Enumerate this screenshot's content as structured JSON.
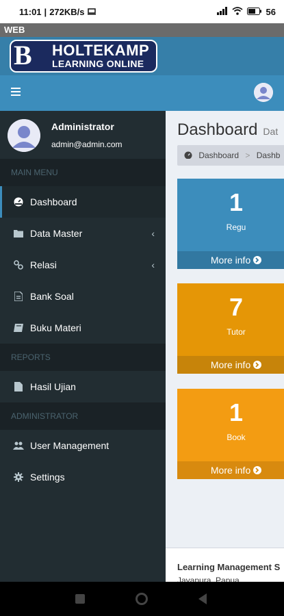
{
  "status_bar": {
    "time": "11:01",
    "speed": "272KB/s",
    "battery": "56"
  },
  "web_title": "WEB",
  "logo": {
    "line1": "HOLTEKAMP",
    "line2": "LEARNING ONLINE",
    "letter": "B"
  },
  "sidebar": {
    "user": {
      "name": "Administrator",
      "email": "admin@admin.com"
    },
    "sections": [
      {
        "header": "MAIN MENU"
      },
      {
        "header": "REPORTS"
      },
      {
        "header": "ADMINISTRATOR"
      }
    ],
    "items": [
      {
        "label": "Dashboard",
        "icon": "dashboard-icon",
        "active": true
      },
      {
        "label": "Data Master",
        "icon": "folder-icon",
        "expandable": true
      },
      {
        "label": "Relasi",
        "icon": "link-icon",
        "expandable": true
      },
      {
        "label": "Bank Soal",
        "icon": "file-text-icon"
      },
      {
        "label": "Buku Materi",
        "icon": "book-icon"
      },
      {
        "label": "Hasil Ujian",
        "icon": "file-icon"
      },
      {
        "label": "User Management",
        "icon": "users-icon"
      },
      {
        "label": "Settings",
        "icon": "gear-icon"
      }
    ]
  },
  "content": {
    "title": "Dashboard",
    "subtitle": "Dat",
    "breadcrumb": [
      "Dashboard",
      "Dashb"
    ],
    "boxes": [
      {
        "value": "1",
        "label": "Regu",
        "more": "More info",
        "color": "#3c8dbc"
      },
      {
        "value": "7",
        "label": "Tutor",
        "more": "More info",
        "color": "#e59606"
      },
      {
        "value": "1",
        "label": "Book",
        "more": "More info",
        "color": "#f39c12"
      }
    ],
    "footer": {
      "line1": "Learning Management S",
      "line2": "Jayapura, Papua"
    }
  },
  "colors": {
    "navbar": "#3c8dbc",
    "sidebar": "#222d32",
    "content_bg": "#ecf0f5"
  }
}
